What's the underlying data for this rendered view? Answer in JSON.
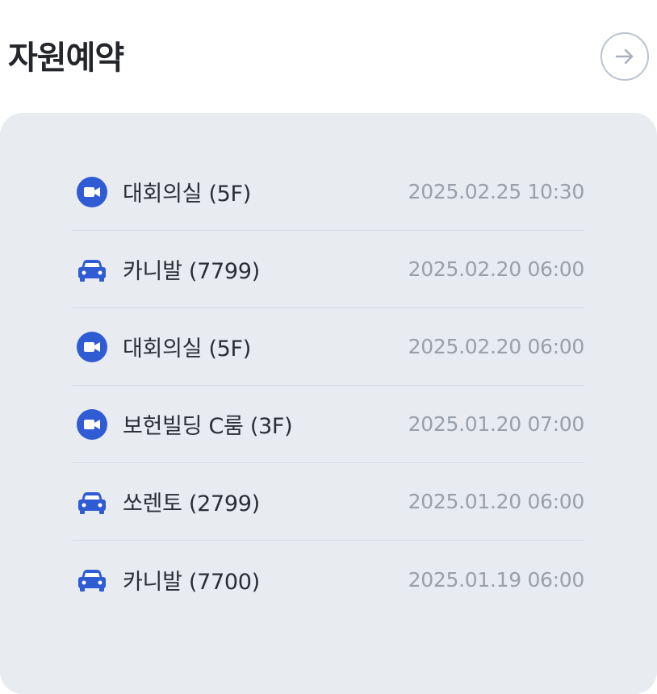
{
  "header": {
    "title": "자원예약",
    "more_icon": "arrow-right-icon"
  },
  "colors": {
    "accent": "#2f5bd3",
    "panel_bg": "#e8ebf0",
    "date_text": "#9aa0a8"
  },
  "reservations": [
    {
      "icon": "video-camera-icon",
      "name": "대회의실 (5F)",
      "datetime": "2025.02.25 10:30"
    },
    {
      "icon": "car-icon",
      "name": "카니발 (7799)",
      "datetime": "2025.02.20 06:00"
    },
    {
      "icon": "video-camera-icon",
      "name": "대회의실 (5F)",
      "datetime": "2025.02.20 06:00"
    },
    {
      "icon": "video-camera-icon",
      "name": "보헌빌딩 C룸 (3F)",
      "datetime": "2025.01.20 07:00"
    },
    {
      "icon": "car-icon",
      "name": "쏘렌토 (2799)",
      "datetime": "2025.01.20 06:00"
    },
    {
      "icon": "car-icon",
      "name": "카니발 (7700)",
      "datetime": "2025.01.19 06:00"
    }
  ]
}
